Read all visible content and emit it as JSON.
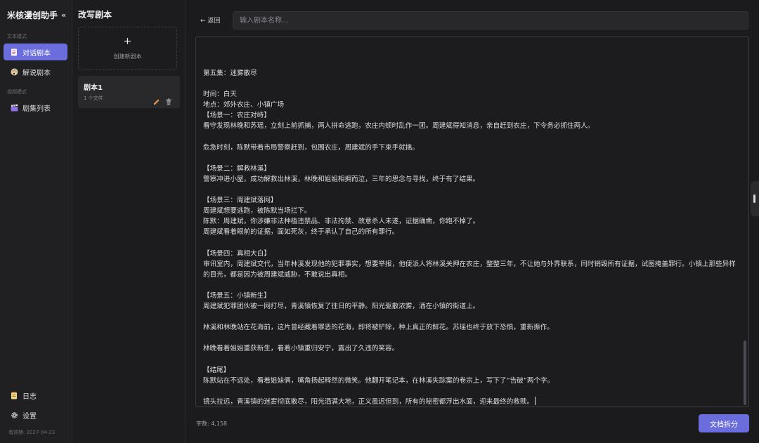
{
  "sidebar": {
    "brand": "米核漫创助手",
    "collapse_glyph": "«",
    "section_text": "文本模式",
    "section_video": "视频模式",
    "items": [
      {
        "label": "对话剧本",
        "icon": "doc-icon",
        "active": true
      },
      {
        "label": "解说剧本",
        "icon": "palette-icon",
        "active": false
      },
      {
        "label": "剧集列表",
        "icon": "clapper-icon",
        "active": false
      }
    ],
    "log_label": "日志",
    "settings_label": "设置",
    "expire": "有效期: 2027-04-23"
  },
  "scripts": {
    "title": "改写剧本",
    "create_plus": "+",
    "create_label": "创建新剧本",
    "cards": [
      {
        "name": "剧本1",
        "meta": "1 个文件"
      }
    ]
  },
  "header": {
    "back_label": "← 返回",
    "title_placeholder": "输入剧本名称..."
  },
  "editor": {
    "content": "第五集：迷雾散尽\n\n时间：白天\n地点：郊外农庄、小镇广场\n【场景一：农庄对峙】\n看守发现林晚和苏瑶，立刻上前抓捕，两人拼命逃跑，农庄内顿时乱作一团。周建斌得知消息，亲自赶到农庄，下令务必抓住两人。\n\n危急时刻，陈默带着市局警察赶到，包围农庄，周建斌的手下束手就擒。\n\n【场景二：解救林溪】\n警察冲进小屋，成功解救出林溪，林晚和姐姐相拥而泣，三年的思念与寻找，终于有了结果。\n\n【场景三：周建斌落网】\n周建斌想要逃跑，被陈默当场拦下。\n陈默：周建斌，你涉嫌非法种植违禁品、非法拘禁、故意杀人未遂，证据确凿，你跑不掉了。\n周建斌看着眼前的证据，面如死灰，终于承认了自己的所有罪行。\n\n【场景四：真相大白】\n审讯室内，周建斌交代，当年林溪发现他的犯罪事实，想要举报，他便派人将林溪关押在农庄，整整三年，不让她与外界联系，同时销毁所有证据，试图掩盖罪行。小镇上那些异样的目光，都是因为被周建斌威胁，不敢说出真相。\n\n【场景五：小镇新生】\n周建斌犯罪团伙被一网打尽，青溪镇恢复了往日的平静。阳光驱散浓雾，洒在小镇的街道上。\n\n林溪和林晚站在花海前，这片曾经藏着罪恶的花海，即将被铲除，种上真正的鲜花。苏瑶也终于放下恐惧，重新振作。\n\n林晚看着姐姐重获新生，看着小镇重归安宁，露出了久违的笑容。\n\n【结尾】\n陈默站在不远处，看着姐妹俩，嘴角扬起释然的微笑。他翻开笔记本，在林溪失踪案的卷宗上，写下了“告破”两个字。\n\n镜头拉远，青溪镇的迷雾彻底散尽，阳光洒满大地，正义虽迟但到，所有的秘密都浮出水面，迎来最终的救赎。"
  },
  "footer": {
    "word_count": "字数: 4,158",
    "split_label": "文档拆分"
  },
  "colors": {
    "accent": "#6b6ddc",
    "background": "#1b1b1d",
    "sidebar": "#202022"
  }
}
